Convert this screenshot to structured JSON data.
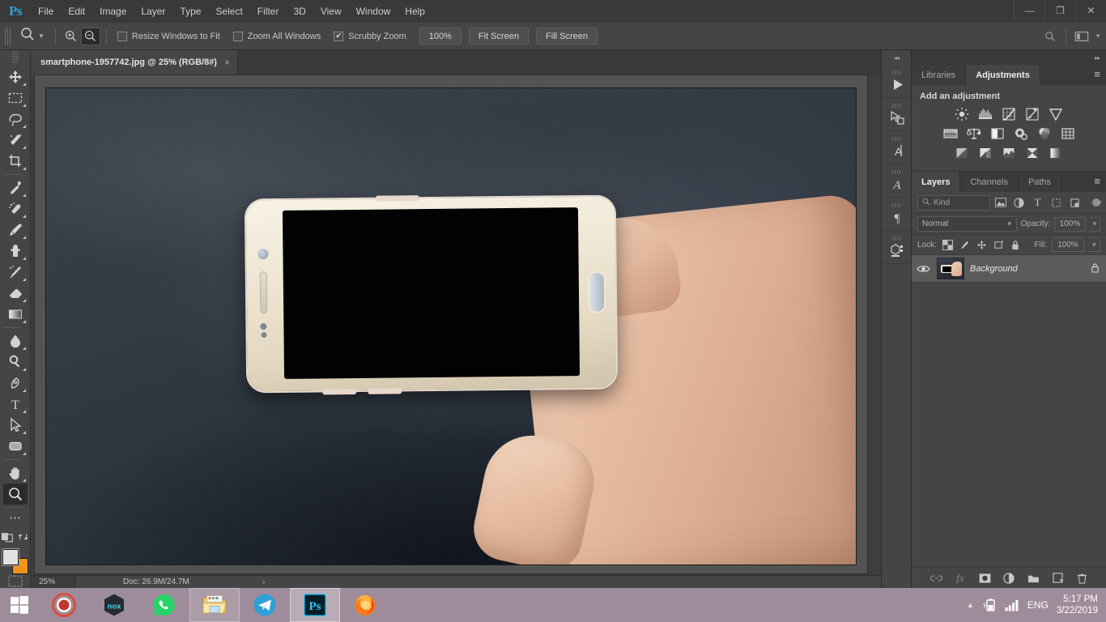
{
  "app": {
    "logo": "Ps",
    "menus": [
      "File",
      "Edit",
      "Image",
      "Layer",
      "Type",
      "Select",
      "Filter",
      "3D",
      "View",
      "Window",
      "Help"
    ],
    "window_controls": {
      "minimize": "—",
      "restore": "❐",
      "close": "✕"
    }
  },
  "options_bar": {
    "zoom_in_icon": "zoom-in-icon",
    "zoom_out_icon": "zoom-out-icon",
    "resize_windows_label": "Resize Windows to Fit",
    "resize_windows_checked": false,
    "zoom_all_label": "Zoom All Windows",
    "zoom_all_checked": false,
    "scrubby_label": "Scrubby Zoom",
    "scrubby_checked": true,
    "btn_100": "100%",
    "btn_fit": "Fit Screen",
    "btn_fill": "Fill Screen",
    "search_icon": "search-icon",
    "workspace_icon": "workspace-icon"
  },
  "toolbar": {
    "tools": [
      {
        "name": "move-tool",
        "glyph": "✥",
        "active": false,
        "tri": true
      },
      {
        "name": "rectangular-marquee-tool",
        "glyph": "⬚",
        "active": false,
        "tri": true
      },
      {
        "name": "lasso-tool",
        "glyph": "✒",
        "active": false,
        "tri": true
      },
      {
        "name": "magic-wand-tool",
        "glyph": "✨",
        "active": false,
        "tri": true
      },
      {
        "name": "crop-tool",
        "glyph": "⛏",
        "active": false,
        "tri": true
      },
      {
        "name": "eyedropper-tool",
        "glyph": "⚗",
        "active": false,
        "tri": true
      },
      {
        "name": "spot-healing-brush-tool",
        "glyph": "❁",
        "active": false,
        "tri": true
      },
      {
        "name": "brush-tool",
        "glyph": "✎",
        "active": false,
        "tri": true
      },
      {
        "name": "clone-stamp-tool",
        "glyph": "⚑",
        "active": false,
        "tri": true
      },
      {
        "name": "history-brush-tool",
        "glyph": "✐",
        "active": false,
        "tri": true
      },
      {
        "name": "eraser-tool",
        "glyph": "▱",
        "active": false,
        "tri": true
      },
      {
        "name": "gradient-tool",
        "glyph": "■",
        "active": false,
        "tri": true
      },
      {
        "name": "blur-tool",
        "glyph": "●",
        "active": false,
        "tri": true
      },
      {
        "name": "dodge-tool",
        "glyph": "⚲",
        "active": false,
        "tri": true
      },
      {
        "name": "pen-tool",
        "glyph": "✒",
        "active": false,
        "tri": true
      },
      {
        "name": "type-tool",
        "glyph": "T",
        "active": false,
        "tri": true
      },
      {
        "name": "path-selection-tool",
        "glyph": "➤",
        "active": false,
        "tri": true
      },
      {
        "name": "rectangle-tool",
        "glyph": "▭",
        "active": false,
        "tri": true
      },
      {
        "name": "hand-tool",
        "glyph": "✋",
        "active": false,
        "tri": true
      },
      {
        "name": "zoom-tool",
        "glyph": "⌕",
        "active": true,
        "tri": false
      },
      {
        "name": "edit-toolbar-tool",
        "glyph": "⋯",
        "active": false,
        "tri": true
      }
    ],
    "foreground_color": "#e2e2de",
    "background_color": "#f0921e",
    "quick_mask_icon": "quick-mask-icon",
    "swap_colors_icon": "swap-colors-icon"
  },
  "document": {
    "tab_title": "smartphone-1957742.jpg @ 25% (RGB/8#)",
    "close_glyph": "×"
  },
  "status_bar": {
    "zoom": "25%",
    "doc_info": "Doc: 26.9M/24.7M",
    "expand_glyph": "›"
  },
  "icon_dock": {
    "collapse_glyph": "◂◂",
    "items": [
      {
        "name": "timeline-play-icon",
        "glyph": "▶"
      },
      {
        "name": "path-select-icon",
        "glyph": "◱"
      },
      {
        "name": "character-panel-icon",
        "glyph": "A"
      },
      {
        "name": "glyphs-panel-icon",
        "glyph": "𝒜"
      },
      {
        "name": "paragraph-panel-icon",
        "glyph": "¶"
      },
      {
        "name": "properties-panel-icon",
        "glyph": "⬛"
      }
    ]
  },
  "panels": {
    "collapse_glyph": "▸▸",
    "top_tabs": [
      {
        "name": "tab-libraries",
        "label": "Libraries",
        "active": false
      },
      {
        "name": "tab-adjustments",
        "label": "Adjustments",
        "active": true
      }
    ],
    "panel_menu_glyph": "≡",
    "adjustments": {
      "title": "Add an adjustment",
      "rows": [
        [
          {
            "name": "brightness-contrast-icon",
            "glyph": "☀"
          },
          {
            "name": "levels-icon",
            "glyph": "░"
          },
          {
            "name": "curves-icon",
            "glyph": "⎇"
          },
          {
            "name": "exposure-icon",
            "glyph": "±"
          },
          {
            "name": "vibrance-icon",
            "glyph": "▽"
          }
        ],
        [
          {
            "name": "hue-saturation-icon",
            "glyph": "▒"
          },
          {
            "name": "color-balance-icon",
            "glyph": "⚖"
          },
          {
            "name": "black-and-white-icon",
            "glyph": "◑"
          },
          {
            "name": "photo-filter-icon",
            "glyph": "◔"
          },
          {
            "name": "channel-mixer-icon",
            "glyph": "◎"
          },
          {
            "name": "color-lookup-icon",
            "glyph": "⊞"
          }
        ],
        [
          {
            "name": "invert-icon",
            "glyph": "◨"
          },
          {
            "name": "posterize-icon",
            "glyph": "▧"
          },
          {
            "name": "threshold-icon",
            "glyph": "⌇"
          },
          {
            "name": "gradient-map-icon",
            "glyph": "⨉"
          },
          {
            "name": "selective-color-icon",
            "glyph": "◧"
          }
        ]
      ]
    },
    "layers": {
      "tabs": [
        {
          "name": "tab-layers",
          "label": "Layers",
          "active": true
        },
        {
          "name": "tab-channels",
          "label": "Channels",
          "active": false
        },
        {
          "name": "tab-paths",
          "label": "Paths",
          "active": false
        }
      ],
      "menu_glyph": "≡",
      "filter_kind_label": "Kind",
      "filter_search_icon": "search-icon",
      "filter_icons": [
        {
          "name": "filter-pixel-icon",
          "glyph": "⛰"
        },
        {
          "name": "filter-adjustment-icon",
          "glyph": "◑"
        },
        {
          "name": "filter-type-icon",
          "glyph": "T"
        },
        {
          "name": "filter-shape-icon",
          "glyph": "⬚"
        },
        {
          "name": "filter-smart-object-icon",
          "glyph": "❐"
        }
      ],
      "blend_mode": "Normal",
      "opacity_label": "Opacity:",
      "opacity_value": "100%",
      "lock_label": "Lock:",
      "lock_icons": [
        {
          "name": "lock-transparent-pixels-icon",
          "glyph": "▦"
        },
        {
          "name": "lock-image-pixels-icon",
          "glyph": "✎"
        },
        {
          "name": "lock-position-icon",
          "glyph": "✥"
        },
        {
          "name": "lock-artboard-nesting-icon",
          "glyph": "◱"
        },
        {
          "name": "lock-all-icon",
          "glyph": "🔒"
        }
      ],
      "fill_label": "Fill:",
      "fill_value": "100%",
      "rows": [
        {
          "name": "Background",
          "visible": true,
          "locked": true,
          "lock_glyph": "🔒",
          "eye_glyph": "👁"
        }
      ],
      "footer_icons": [
        {
          "name": "link-layers-icon",
          "glyph": "⚭"
        },
        {
          "name": "layer-style-fx-icon",
          "glyph": "fx"
        },
        {
          "name": "add-layer-mask-icon",
          "glyph": "▣"
        },
        {
          "name": "new-adjustment-layer-icon",
          "glyph": "◑"
        },
        {
          "name": "new-group-icon",
          "glyph": "📁"
        },
        {
          "name": "new-layer-icon",
          "glyph": "⧉"
        },
        {
          "name": "delete-layer-icon",
          "glyph": "🗑"
        }
      ]
    }
  },
  "taskbar": {
    "start_icon": "windows-start-icon",
    "apps": [
      {
        "name": "taskbar-recorder",
        "label": "recorder",
        "state": "idle"
      },
      {
        "name": "taskbar-nox",
        "label": "nox",
        "state": "idle"
      },
      {
        "name": "taskbar-whatsapp",
        "label": "WhatsApp",
        "state": "idle"
      },
      {
        "name": "taskbar-file-explorer",
        "label": "File Explorer",
        "state": "open"
      },
      {
        "name": "taskbar-telegram",
        "label": "Telegram",
        "state": "idle"
      },
      {
        "name": "taskbar-photoshop",
        "label": "Ps",
        "state": "active"
      },
      {
        "name": "taskbar-firefox",
        "label": "Firefox",
        "state": "idle"
      }
    ],
    "tray": {
      "show_hidden_glyph": "▲",
      "battery_icon": "battery-charging-icon",
      "network_icon": "signal-bars-icon",
      "language": "ENG",
      "time": "5:17 PM",
      "date": "3/22/2019"
    }
  }
}
